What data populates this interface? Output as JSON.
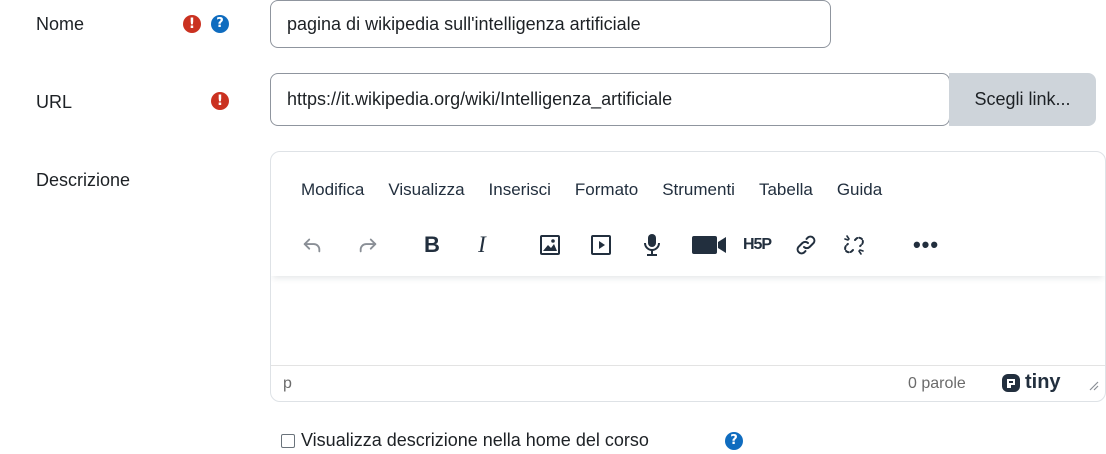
{
  "form": {
    "name": {
      "label": "Nome",
      "value": "pagina di wikipedia sull'intelligenza artificiale"
    },
    "url": {
      "label": "URL",
      "value": "https://it.wikipedia.org/wiki/Intelligenza_artificiale",
      "button": "Scegli link..."
    },
    "description": {
      "label": "Descrizione"
    },
    "show_description": {
      "label": "Visualizza descrizione nella home del corso",
      "checked": false
    }
  },
  "editor": {
    "menu": [
      "Modifica",
      "Visualizza",
      "Inserisci",
      "Formato",
      "Strumenti",
      "Tabella",
      "Guida"
    ],
    "toolbar_icons": [
      "undo-icon",
      "redo-icon",
      "bold-icon",
      "italic-icon",
      "image-icon",
      "media-icon",
      "record-audio-icon",
      "record-video-icon",
      "h5p-icon",
      "link-icon",
      "unlink-icon",
      "more-icon"
    ],
    "status_path": "p",
    "word_count": "0 parole",
    "brand": "tiny"
  },
  "colors": {
    "required": "#ca3120",
    "help": "#0f6cbf",
    "button_bg": "#ced4da"
  }
}
